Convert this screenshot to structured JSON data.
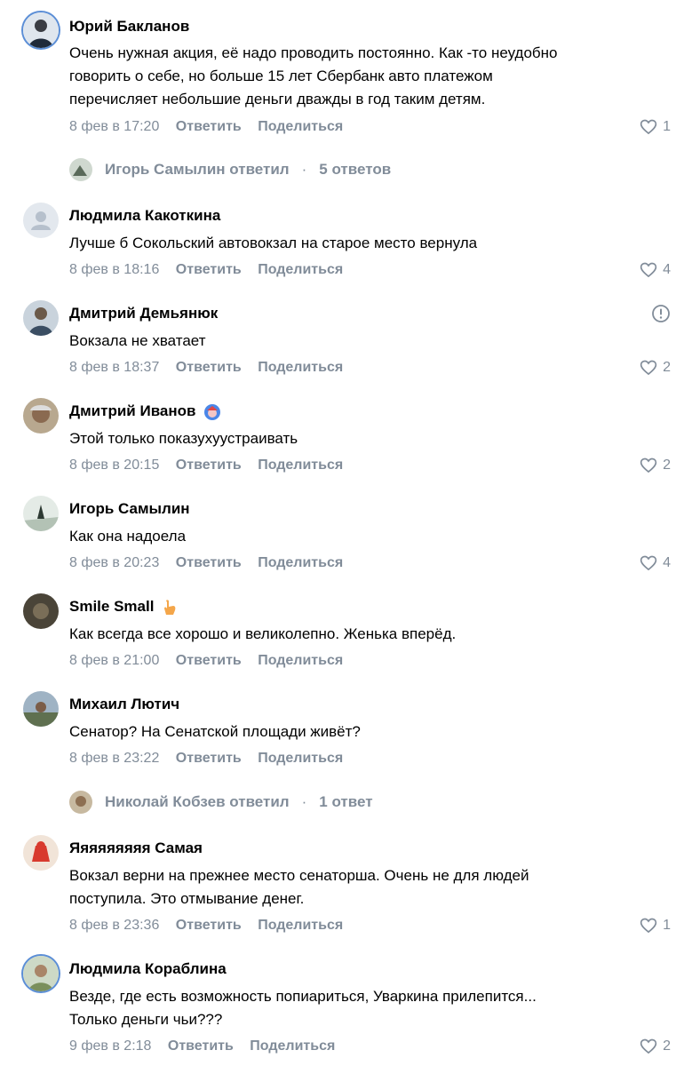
{
  "actions": {
    "reply": "Ответить",
    "share": "Поделиться"
  },
  "colors": {
    "meta": "#818c99",
    "accent": "#2688eb"
  },
  "comments": [
    {
      "author": "Юрий Бакланов",
      "text": [
        "Очень нужная акция, её надо проводить постоянно. Как -то неудобно",
        "говорить о себе, но больше 15 лет Сбербанк авто платежом",
        "перечисляет небольшие деньги дважды в год таким детям."
      ],
      "time": "8 фев в 17:20",
      "likes": "1",
      "replies": {
        "who": "Игорь Самылин ответил",
        "count": "5 ответов"
      }
    },
    {
      "author": "Людмила Какоткина",
      "text": [
        "Лучше б Сокольский автовокзал на старое место вернула"
      ],
      "time": "8 фев в 18:16",
      "likes": "4"
    },
    {
      "author": "Дмитрий Демьянюк",
      "text": [
        "Вокзала не хватает"
      ],
      "time": "8 фев в 18:37",
      "likes": "2"
    },
    {
      "author": "Дмитрий Иванов",
      "text": [
        "Этой только показухуустраивать"
      ],
      "time": "8 фев в 20:15",
      "likes": "2"
    },
    {
      "author": "Игорь Самылин",
      "text": [
        "Как она надоела"
      ],
      "time": "8 фев в 20:23",
      "likes": "4"
    },
    {
      "author": "Smile Small",
      "text": [
        "Как всегда все хорошо и великолепно. Женька вперёд."
      ],
      "time": "8 фев в 21:00",
      "likes": ""
    },
    {
      "author": "Михаил Лютич",
      "text": [
        "Сенатор? На Сенатской площади живёт?"
      ],
      "time": "8 фев в 23:22",
      "likes": "",
      "replies": {
        "who": "Николай Кобзев ответил",
        "count": "1 ответ"
      }
    },
    {
      "author": "Яяяяяяяяя Самая",
      "text": [
        "Вокзал верни на прежнее место сенаторша. Очень не для людей",
        "поступила. Это отмывание денег."
      ],
      "time": "8 фев в 23:36",
      "likes": "1"
    },
    {
      "author": "Людмила Кораблина",
      "text": [
        "Везде, где есть возможность попиариться, Уваркина прилепится...",
        "Только деньги чьи???"
      ],
      "time": "9 фев в 2:18",
      "likes": "2"
    }
  ]
}
